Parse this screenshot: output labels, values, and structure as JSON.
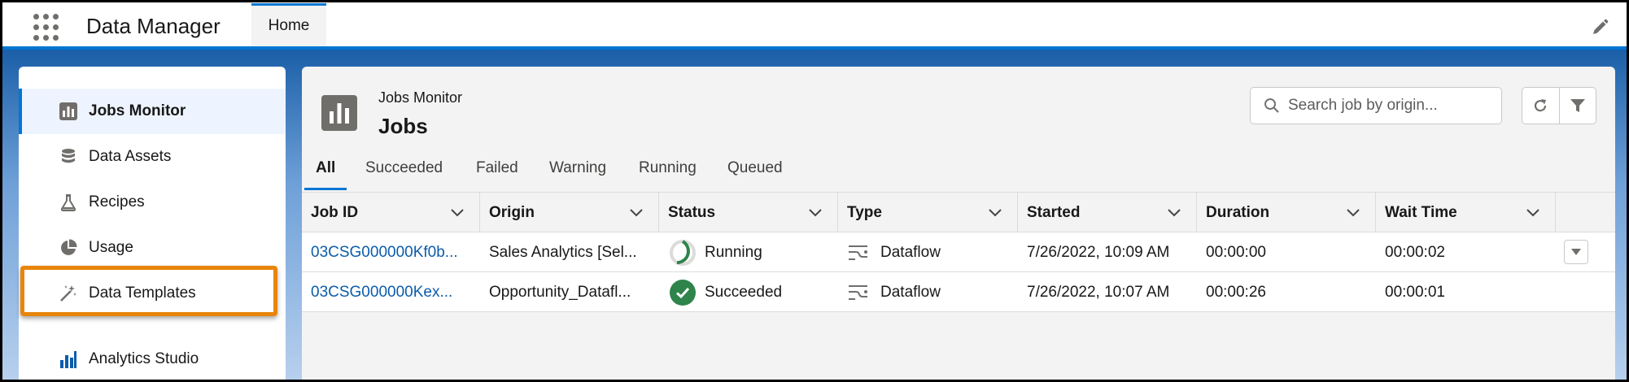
{
  "header": {
    "app_title": "Data Manager",
    "tab_home": "Home"
  },
  "sidebar": {
    "items": [
      {
        "label": "Jobs Monitor",
        "icon": "jobs-monitor-icon",
        "active": true
      },
      {
        "label": "Data Assets",
        "icon": "database-icon"
      },
      {
        "label": "Recipes",
        "icon": "flask-icon"
      },
      {
        "label": "Usage",
        "icon": "pie-chart-icon"
      },
      {
        "label": "Data Templates",
        "icon": "magic-wand-icon",
        "highlighted": true
      },
      {
        "label": "Analytics Studio",
        "icon": "analytics-studio-icon"
      }
    ]
  },
  "main": {
    "subtitle": "Jobs Monitor",
    "title": "Jobs",
    "search_placeholder": "Search job by origin...",
    "tabs": [
      "All",
      "Succeeded",
      "Failed",
      "Warning",
      "Running",
      "Queued"
    ],
    "active_tab": "All",
    "columns": [
      "Job ID",
      "Origin",
      "Status",
      "Type",
      "Started",
      "Duration",
      "Wait Time"
    ],
    "rows": [
      {
        "job_id": "03CSG000000Kf0b...",
        "origin": "Sales Analytics [Sel...",
        "status": "Running",
        "type": "Dataflow",
        "started": "7/26/2022, 10:09 AM",
        "duration": "00:00:00",
        "wait_time": "00:00:02"
      },
      {
        "job_id": "03CSG000000Kex...",
        "origin": "Opportunity_Datafl...",
        "status": "Succeeded",
        "type": "Dataflow",
        "started": "7/26/2022, 10:07 AM",
        "duration": "00:00:26",
        "wait_time": "00:00:01"
      }
    ]
  },
  "colors": {
    "brand_blue": "#0176d3",
    "link_blue": "#0b5cab",
    "success_green": "#2e844a",
    "highlight_orange": "#e8850c"
  }
}
